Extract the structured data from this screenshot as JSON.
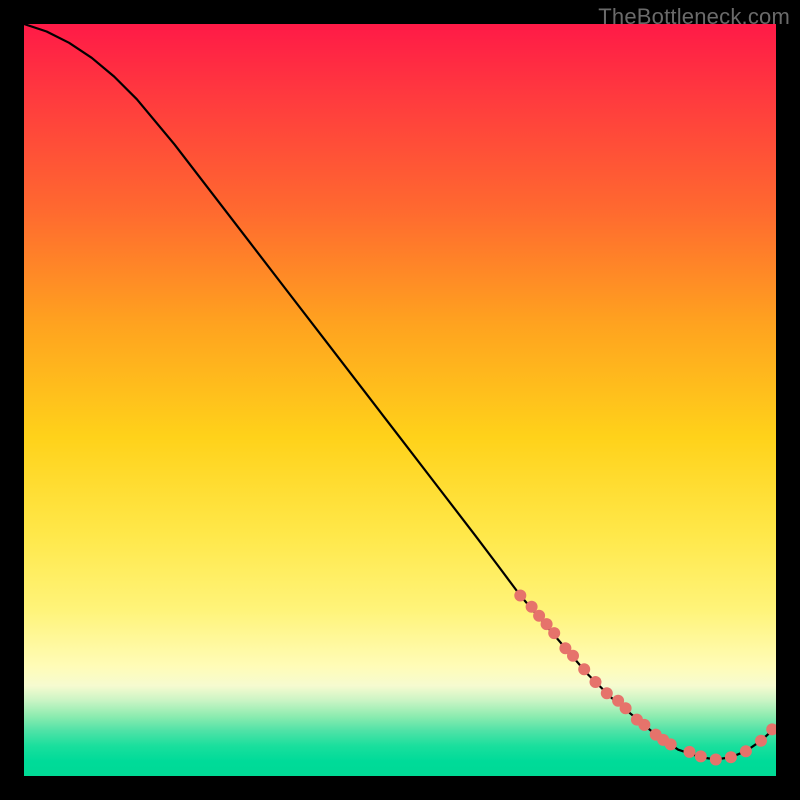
{
  "watermark": "TheBottleneck.com",
  "chart_data": {
    "type": "line",
    "title": "",
    "xlabel": "",
    "ylabel": "",
    "xlim": [
      0,
      100
    ],
    "ylim": [
      0,
      100
    ],
    "grid": false,
    "legend": false,
    "series": [
      {
        "name": "curve",
        "style": "line",
        "color": "#000000",
        "x": [
          0,
          3,
          6,
          9,
          12,
          15,
          20,
          25,
          30,
          35,
          40,
          45,
          50,
          55,
          60,
          63,
          66,
          69,
          72,
          75,
          78,
          81,
          84,
          87,
          90,
          92,
          94,
          96,
          98,
          100
        ],
        "y": [
          100,
          99,
          97.5,
          95.5,
          93,
          90,
          84,
          77.5,
          71,
          64.5,
          58,
          51.5,
          45,
          38.5,
          32,
          28,
          24,
          20.5,
          17,
          13.5,
          10.5,
          8,
          5.5,
          3.5,
          2.5,
          2.2,
          2.5,
          3.3,
          4.7,
          6.5
        ]
      },
      {
        "name": "points-lower-segment",
        "style": "scatter",
        "color": "#e6736b",
        "x": [
          66,
          67.5,
          68.5,
          69.5,
          70.5,
          72,
          73,
          74.5,
          76,
          77.5,
          79,
          80,
          81.5,
          82.5,
          84,
          85,
          86,
          88.5,
          90,
          92,
          94,
          96,
          98,
          99.5
        ],
        "y": [
          24,
          22.5,
          21.3,
          20.2,
          19,
          17,
          16,
          14.2,
          12.5,
          11,
          10,
          9,
          7.5,
          6.8,
          5.5,
          4.8,
          4.2,
          3.2,
          2.6,
          2.2,
          2.5,
          3.3,
          4.7,
          6.2
        ]
      }
    ]
  },
  "colors": {
    "background": "#000000",
    "curve": "#000000",
    "points": "#e6736b",
    "watermark": "#6a6a6a"
  }
}
